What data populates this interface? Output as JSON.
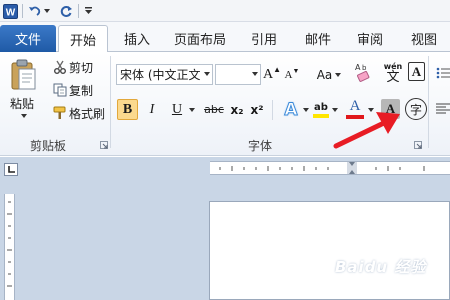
{
  "quick_access": {
    "app_icon": "W",
    "undo_icon": "undo-arrow",
    "redo_icon": "repeat-arrow"
  },
  "tabs": [
    "文件",
    "开始",
    "插入",
    "页面布局",
    "引用",
    "邮件",
    "审阅",
    "视图"
  ],
  "clipboard": {
    "paste_label": "粘贴",
    "cut_label": "剪切",
    "copy_label": "复制",
    "format_painter_label": "格式刷",
    "group_label": "剪贴板"
  },
  "font": {
    "font_name": "宋体 (中文正文",
    "font_size": "",
    "grow_label": "A",
    "shrink_label": "A",
    "change_case_label": "Aa",
    "bold_label": "B",
    "italic_label": "I",
    "underline_label": "U",
    "strike_label": "abc",
    "subscript_label": "x₂",
    "superscript_label": "x²",
    "effects_label": "A",
    "highlight_label": "ab",
    "font_color_label": "A",
    "shading_label": "A",
    "enclose_label": "字",
    "phonetic_label": "wén",
    "border_label": "A",
    "group_label": "字体"
  },
  "colors": {
    "accent_blue": "#1f5aa6",
    "highlight_yellow": "#ffe600",
    "font_red": "#e0181c",
    "arrow_red": "#e81c24",
    "bold_active": "#fbd98e"
  },
  "watermark": "Baidu 经验"
}
